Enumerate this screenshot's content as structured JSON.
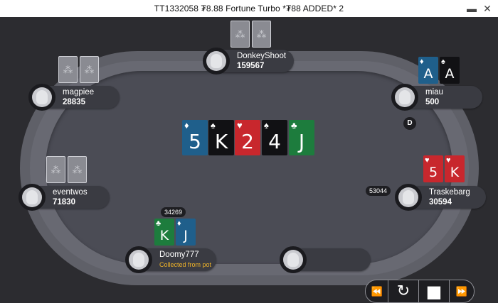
{
  "window": {
    "title": "TT1332058 ₮8.88 Fortune Turbo *₮88 ADDED* 2",
    "minimize_icon": "minimize-icon",
    "close_icon": "close-icon"
  },
  "players": [
    {
      "id": "donkeyshoot",
      "name": "DonkeyShoot",
      "chips": "159567"
    },
    {
      "id": "magpiee",
      "name": "magpiee",
      "chips": "28835"
    },
    {
      "id": "miau",
      "name": "miau",
      "chips": "500"
    },
    {
      "id": "eventwos",
      "name": "eventwos",
      "chips": "71830"
    },
    {
      "id": "traskebarg",
      "name": "Traskebarg",
      "chips": "30594"
    },
    {
      "id": "doomy777",
      "name": "Doomy777",
      "note": "Collected from pot"
    }
  ],
  "bets": {
    "traskebarg": "53044",
    "doomy777": "34269"
  },
  "dealer_button": "D",
  "board": [
    {
      "rank": "5",
      "suit": "♦",
      "color": "#1f5f8b"
    },
    {
      "rank": "K",
      "suit": "♠",
      "color": "#111114"
    },
    {
      "rank": "2",
      "suit": "♥",
      "color": "#c8272d"
    },
    {
      "rank": "4",
      "suit": "♠",
      "color": "#111114"
    },
    {
      "rank": "J",
      "suit": "♣",
      "color": "#1d7c3d"
    }
  ],
  "hole_cards": {
    "miau": [
      {
        "rank": "A",
        "suit": "♦"
      },
      {
        "rank": "A",
        "suit": "♠"
      }
    ],
    "traskebarg": [
      {
        "rank": "5",
        "suit": "♥"
      },
      {
        "rank": "K",
        "suit": "♥"
      }
    ],
    "doomy777": [
      {
        "rank": "K",
        "suit": "♣"
      },
      {
        "rank": "J",
        "suit": "♦"
      }
    ]
  },
  "card_back_symbol": "⁂",
  "controls": {
    "rewind_icon": "⏪",
    "replay_icon": "↻",
    "stop_icon": "■",
    "fast_forward_icon": "⏩"
  },
  "colors": {
    "table_felt": "#4b4c55",
    "table_rail": "#5f6068",
    "background": "#2c2c30",
    "note_text": "#f0b429"
  }
}
